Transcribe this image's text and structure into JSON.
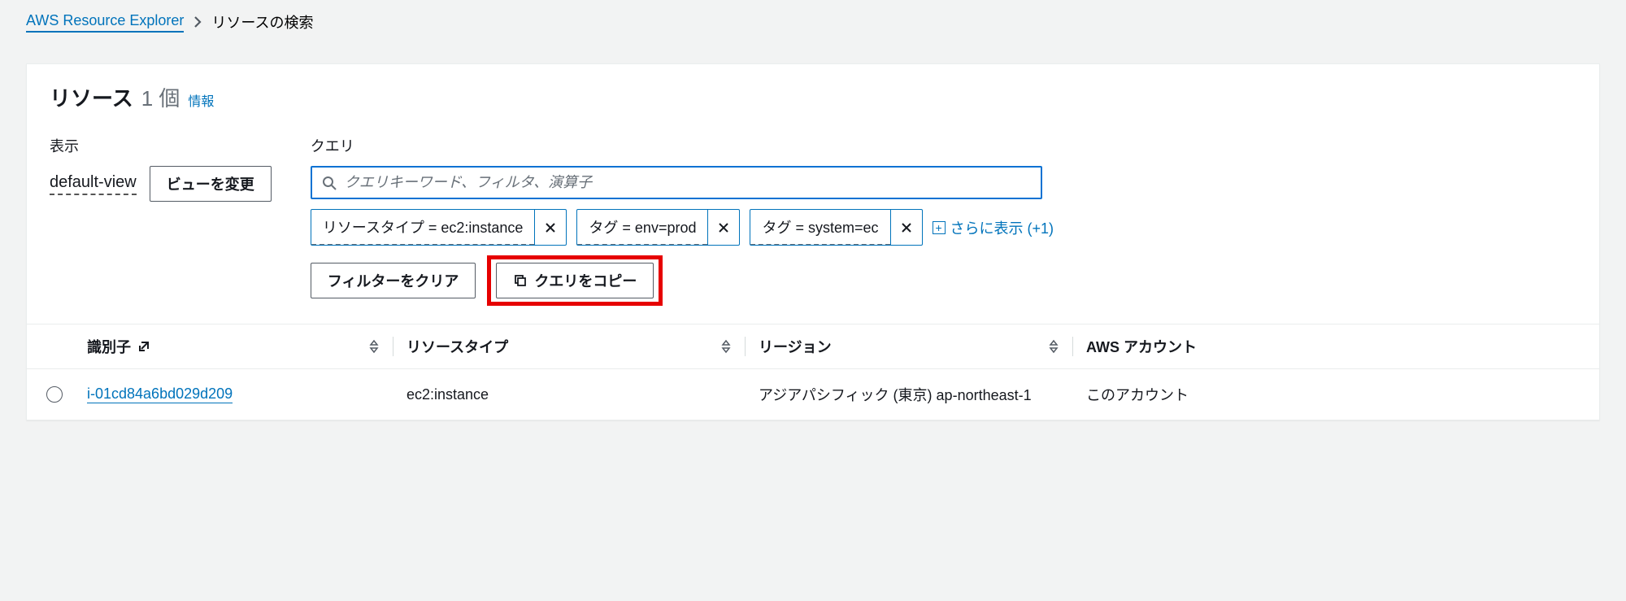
{
  "breadcrumb": {
    "root": "AWS Resource Explorer",
    "current": "リソースの検索"
  },
  "header": {
    "title": "リソース",
    "count": "1 個",
    "info_label": "情報"
  },
  "controls": {
    "view_label": "表示",
    "view_name": "default-view",
    "change_view_btn": "ビューを変更",
    "query_label": "クエリ",
    "search_placeholder": "クエリキーワード、フィルタ、演算子"
  },
  "chips": [
    {
      "text": "リソースタイプ = ec2:instance"
    },
    {
      "text": "タグ = env=prod"
    },
    {
      "text": "タグ = system=ec"
    }
  ],
  "show_more": "さらに表示 (+1)",
  "actions": {
    "clear_filter": "フィルターをクリア",
    "copy_query": "クエリをコピー"
  },
  "table": {
    "columns": {
      "id": "識別子",
      "type": "リソースタイプ",
      "region": "リージョン",
      "account": "AWS アカウント"
    },
    "rows": [
      {
        "id": "i-01cd84a6bd029d209",
        "type": "ec2:instance",
        "region": "アジアパシフィック (東京) ap-northeast-1",
        "account": "このアカウント"
      }
    ]
  }
}
